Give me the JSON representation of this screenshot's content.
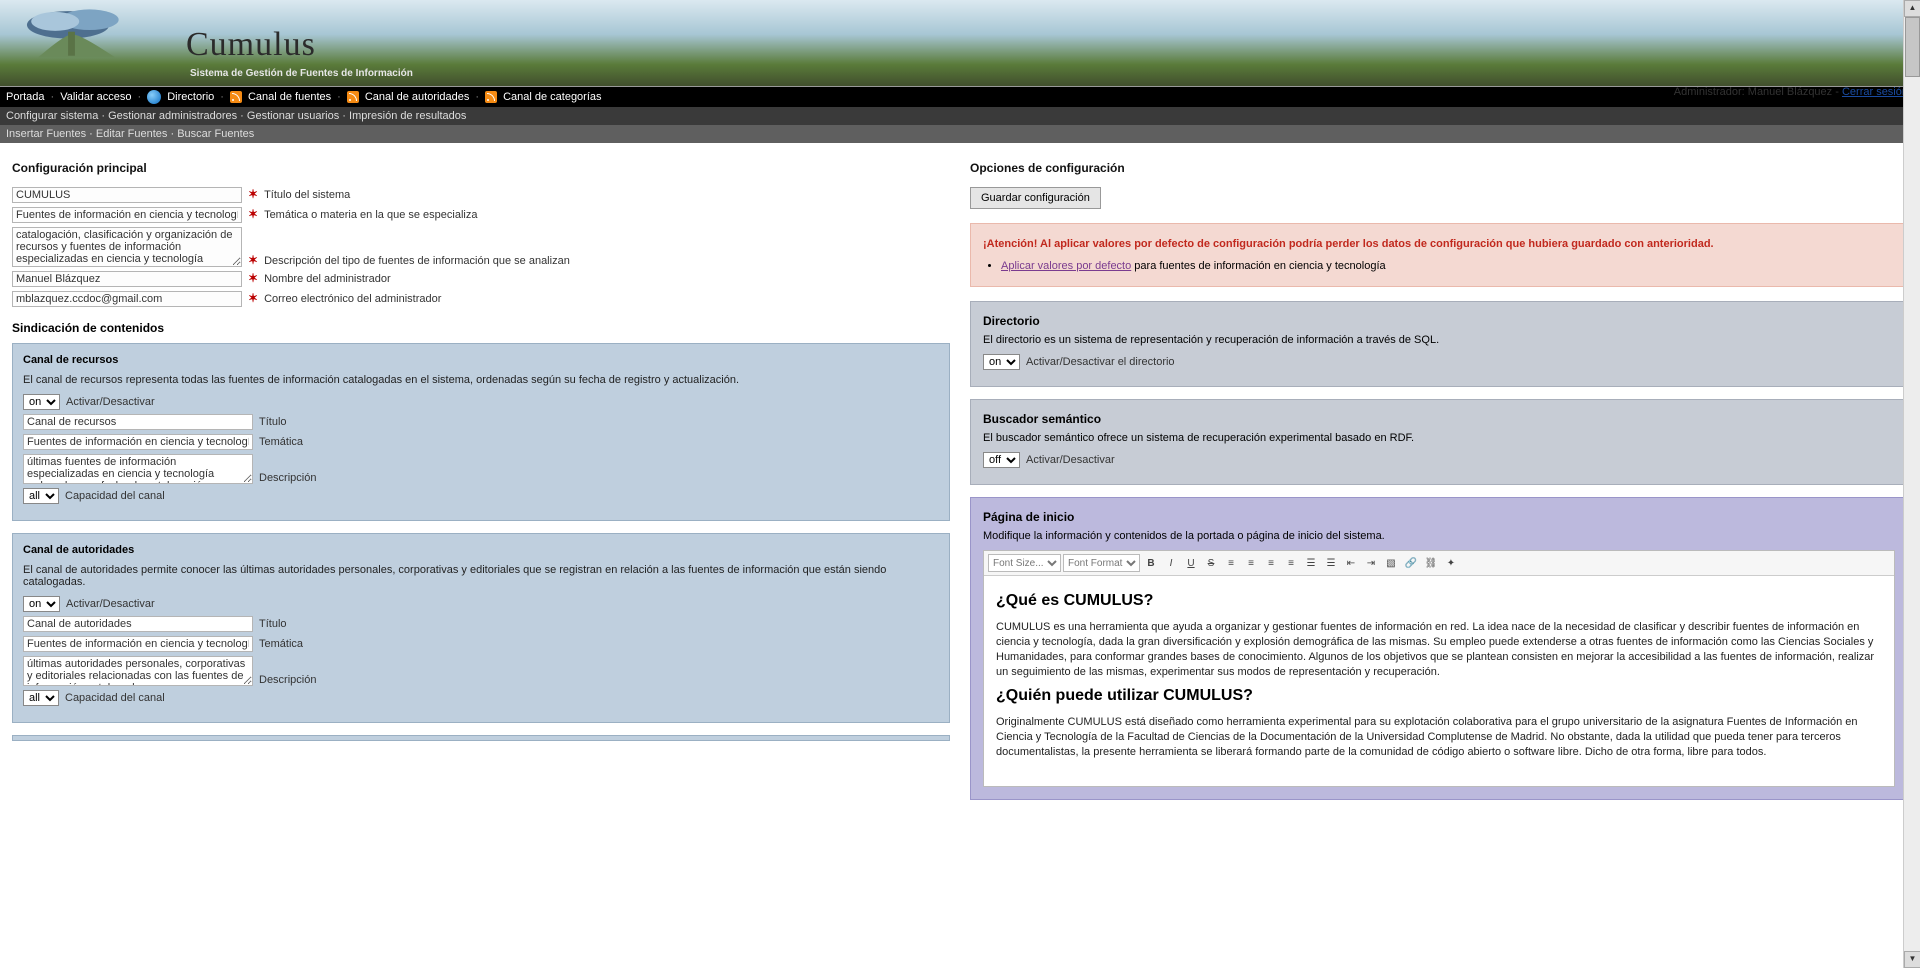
{
  "brand": {
    "title": "Cumulus",
    "subtitle": "Sistema de Gestión de Fuentes de Información"
  },
  "adminbar": {
    "role": "Administrador:",
    "name": "Manuel Blázquez",
    "dash": " - ",
    "logout": "Cerrar sesión"
  },
  "nav1": {
    "portada": "Portada",
    "validar": "Validar acceso",
    "directorio": "Directorio",
    "fuentes": "Canal de fuentes",
    "autoridades": "Canal de autoridades",
    "categorias": "Canal de categorías"
  },
  "nav2": {
    "config": "Configurar sistema",
    "gestadmin": "Gestionar administradores",
    "gestuser": "Gestionar usuarios",
    "impresion": "Impresión de resultados"
  },
  "nav3": {
    "insertar": "Insertar Fuentes",
    "editar": "Editar Fuentes",
    "buscar": "Buscar Fuentes"
  },
  "left": {
    "title": "Configuración principal",
    "fields": {
      "titulo": {
        "value": "CUMULUS",
        "label": "Título del sistema"
      },
      "tematica": {
        "value": "Fuentes de información en ciencia y tecnología",
        "label": "Temática o materia en la que se especializa"
      },
      "descripcion": {
        "value": "catalogación, clasificación y organización de recursos y fuentes de información especializadas en ciencia y tecnología",
        "label": "Descripción del tipo de fuentes de información que se analizan"
      },
      "admin": {
        "value": "Manuel Blázquez",
        "label": "Nombre del administrador"
      },
      "email": {
        "value": "mblazquez.ccdoc@gmail.com",
        "label": "Correo electrónico del administrador"
      }
    },
    "sindTitle": "Sindicación de contenidos",
    "recursos": {
      "title": "Canal de recursos",
      "desc": "El canal de recursos representa todas las fuentes de información catalogadas en el sistema, ordenadas según su fecha de registro y actualización.",
      "activar": "Activar/Desactivar",
      "on": "on",
      "titulo": {
        "value": "Canal de recursos",
        "label": "Título"
      },
      "tematica": {
        "value": "Fuentes de información en ciencia y tecnología",
        "label": "Temática"
      },
      "descripcion": {
        "value": "últimas fuentes de información especializadas en ciencia y tecnología ordenadas por fecha de catalogación",
        "label": "Descripción"
      },
      "cap": "all",
      "capLabel": "Capacidad del canal"
    },
    "autoridades": {
      "title": "Canal de autoridades",
      "desc": "El canal de autoridades permite conocer las últimas autoridades personales, corporativas y editoriales que se registran en relación a las fuentes de información que están siendo catalogadas.",
      "activar": "Activar/Desactivar",
      "on": "on",
      "titulo": {
        "value": "Canal de autoridades",
        "label": "Título"
      },
      "tematica": {
        "value": "Fuentes de información en ciencia y tecnología",
        "label": "Temática"
      },
      "descripcion": {
        "value": "últimas autoridades personales, corporativas y editoriales relacionadas con las fuentes de información catalogadas.",
        "label": "Descripción"
      },
      "cap": "all",
      "capLabel": "Capacidad del canal"
    }
  },
  "right": {
    "optTitle": "Opciones de configuración",
    "save": "Guardar configuración",
    "warn": "¡Atención! Al aplicar valores por defecto de configuración podría perder los datos de configuración que hubiera guardado con anterioridad.",
    "apply": "Aplicar valores por defecto",
    "applyTail": " para fuentes de información en ciencia y tecnología",
    "directorio": {
      "title": "Directorio",
      "desc": "El directorio es un sistema de representación y recuperación de información a través de SQL.",
      "on": "on",
      "label": "Activar/Desactivar el directorio"
    },
    "buscador": {
      "title": "Buscador semántico",
      "desc": "El buscador semántico ofrece un sistema de recuperación experimental basado en RDF.",
      "off": "off",
      "label": "Activar/Desactivar"
    },
    "pagina": {
      "title": "Página de inicio",
      "desc": "Modifique la información y contenidos de la portada o página de inicio del sistema.",
      "fontsize": "Font Size...",
      "fontformat": "Font Format",
      "h1": "¿Qué es CUMULUS?",
      "p1": "CUMULUS es una herramienta que ayuda a organizar y gestionar fuentes de información en red. La idea nace de la necesidad de clasificar y describir fuentes de información en ciencia y tecnología, dada la gran diversificación y explosión demográfica de las mismas. Su empleo puede extenderse a otras fuentes de información como las Ciencias Sociales y Humanidades, para conformar grandes bases de conocimiento. Algunos de los objetivos que se plantean consisten en mejorar la accesibilidad a las fuentes de información, realizar un seguimiento de las mismas, experimentar sus modos de representación y recuperación.",
      "h2": "¿Quién puede utilizar CUMULUS?",
      "p2": "Originalmente CUMULUS está diseñado como herramienta experimental para su explotación colaborativa para el grupo universitario de la asignatura Fuentes de Información en Ciencia y Tecnología de la Facultad de Ciencias de la Documentación de la Universidad Complutense de Madrid. No obstante, dada la utilidad que pueda tener para terceros documentalistas, la presente herramienta se liberará formando parte de la comunidad de código abierto o software libre. Dicho de otra forma, libre para todos."
    }
  }
}
